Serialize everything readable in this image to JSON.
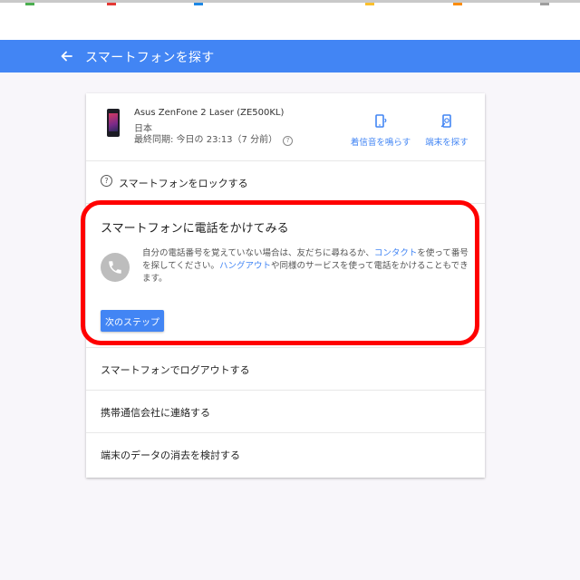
{
  "header": {
    "back_icon": "arrow-left-icon",
    "title": "スマートフォンを探す",
    "color": "#4285f4"
  },
  "device": {
    "name": "Asus ZenFone 2 Laser (ZE500KL)",
    "country": "日本",
    "last_sync": "最終同期: 今日の 23:13（7 分前）",
    "help_glyph": "?",
    "actions": [
      {
        "label": "着信音を鳴らす",
        "icon": "ring-phone-icon"
      },
      {
        "label": "端末を探す",
        "icon": "locate-device-icon"
      }
    ]
  },
  "options": {
    "lock": {
      "label": "スマートフォンをロックする",
      "icon": "help-circle-icon",
      "glyph": "?"
    },
    "call": {
      "title": "スマートフォンに電話をかけてみる",
      "icon": "phone-icon",
      "desc_1": "自分の電話番号を覚えていない場合は、友だちに尋ねるか、",
      "link_contacts": "コンタクト",
      "desc_2": "を使って番号を探してください。",
      "link_hangouts": "ハングアウト",
      "desc_3": "や同様のサービスを使って電話をかけることもできます。",
      "next_button": "次のステップ"
    },
    "logout": {
      "label": "スマートフォンでログアウトする"
    },
    "carrier": {
      "label": "携帯通信会社に連絡する"
    },
    "erase": {
      "label": "端末のデータの消去を検討する"
    }
  },
  "annotation": {
    "color": "#ff0000"
  }
}
